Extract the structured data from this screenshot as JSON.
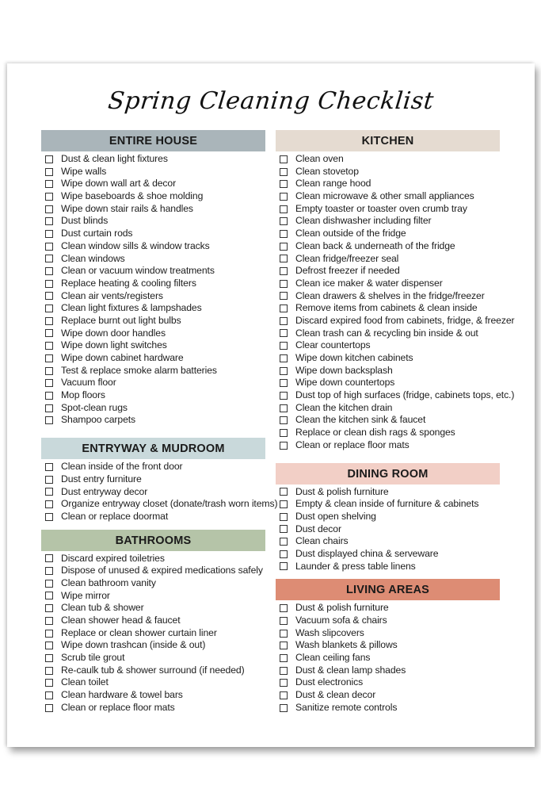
{
  "title": "Spring Cleaning Checklist",
  "colors": {
    "entire_house": "#aab5ba",
    "entryway": "#c9d9db",
    "bathrooms": "#b5c4a8",
    "kitchen": "#e5dbd1",
    "dining_room": "#f2cfc6",
    "living_areas": "#dd8c74"
  },
  "left": [
    {
      "heading": "ENTIRE HOUSE",
      "items": [
        "Dust & clean light fixtures",
        "Wipe walls",
        "Wipe down wall art & decor",
        "Wipe baseboards & shoe molding",
        "Wipe down stair rails & handles",
        "Dust blinds",
        "Dust curtain rods",
        "Clean window sills & window tracks",
        "Clean windows",
        "Clean or vacuum window treatments",
        "Replace heating & cooling filters",
        "Clean air vents/registers",
        "Clean light fixtures & lampshades",
        "Replace burnt out light bulbs",
        "Wipe down door handles",
        "Wipe down light switches",
        "Wipe down cabinet hardware",
        "Test & replace smoke alarm batteries",
        "Vacuum floor",
        "Mop floors",
        "Spot-clean rugs",
        "Shampoo carpets"
      ]
    },
    {
      "heading": "ENTRYWAY & MUDROOM",
      "items": [
        "Clean inside of the front door",
        "Dust entry furniture",
        "Dust entryway decor",
        "Organize entryway closet (donate/trash worn items)",
        "Clean or replace doormat"
      ]
    },
    {
      "heading": "BATHROOMS",
      "items": [
        "Discard expired toiletries",
        "Dispose of unused & expired medications safely",
        "Clean bathroom vanity",
        "Wipe mirror",
        "Clean tub & shower",
        "Clean shower head & faucet",
        "Replace or clean shower curtain liner",
        "Wipe down trashcan (inside & out)",
        "Scrub tile grout",
        "Re-caulk tub & shower surround (if needed)",
        "Clean toilet",
        "Clean hardware & towel bars",
        "Clean or replace floor mats"
      ]
    }
  ],
  "right": [
    {
      "heading": "KITCHEN",
      "items": [
        "Clean oven",
        "Clean stovetop",
        "Clean range hood",
        "Clean microwave & other small appliances",
        "Empty toaster or toaster oven crumb tray",
        "Clean dishwasher including filter",
        "Clean outside of the fridge",
        "Clean back & underneath of the fridge",
        "Clean fridge/freezer seal",
        "Defrost freezer if needed",
        "Clean ice maker & water dispenser",
        "Clean drawers & shelves in the fridge/freezer",
        "Remove items from cabinets & clean inside",
        "Discard expired food from cabinets, fridge, & freezer",
        "Clean trash can & recycling bin inside & out",
        "Clear countertops",
        "Wipe down kitchen cabinets",
        "Wipe down backsplash",
        "Wipe down countertops",
        "Dust top of high surfaces (fridge, cabinets tops, etc.)",
        "Clean the kitchen drain",
        "Clean the kitchen sink & faucet",
        "Replace or clean dish rags & sponges",
        "Clean or replace floor mats"
      ]
    },
    {
      "heading": "DINING ROOM",
      "items": [
        "Dust & polish furniture",
        "Empty & clean inside of furniture & cabinets",
        "Dust open shelving",
        "Dust decor",
        "Clean chairs",
        "Dust displayed china & serveware",
        "Launder & press table linens"
      ]
    },
    {
      "heading": "LIVING AREAS",
      "items": [
        "Dust & polish furniture",
        "Vacuum sofa & chairs",
        "Wash slipcovers",
        "Wash blankets & pillows",
        "Clean ceiling fans",
        "Dust & clean lamp shades",
        "Dust electronics",
        "Dust & clean decor",
        "Sanitize remote controls"
      ]
    }
  ]
}
